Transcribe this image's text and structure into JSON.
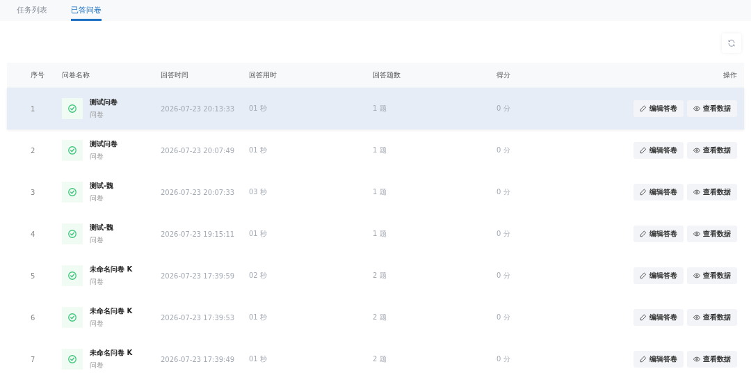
{
  "tabs": [
    {
      "label": "任务列表",
      "selected": false
    },
    {
      "label": "已答问卷",
      "selected": true
    }
  ],
  "table": {
    "columns": [
      "序号",
      "问卷名称",
      "回答时间",
      "回答用时",
      "回答题数",
      "得分",
      "操作"
    ],
    "rows": [
      {
        "index": "1",
        "name": "测试问卷",
        "type": "问卷",
        "time": "2026-07-23 20:13:33",
        "duration": "01 秒",
        "count": "1 题",
        "score": "0 分",
        "selected": true,
        "actions": [
          "编辑答卷",
          "查看数据"
        ]
      },
      {
        "index": "2",
        "name": "测试问卷",
        "type": "问卷",
        "time": "2026-07-23 20:07:49",
        "duration": "01 秒",
        "count": "1 题",
        "score": "0 分",
        "selected": false,
        "actions": [
          "编辑答卷",
          "查看数据"
        ]
      },
      {
        "index": "3",
        "name": "测试-魏",
        "type": "问卷",
        "time": "2026-07-23 20:07:33",
        "duration": "03 秒",
        "count": "1 题",
        "score": "0 分",
        "selected": false,
        "actions": [
          "编辑答卷",
          "查看数据"
        ]
      },
      {
        "index": "4",
        "name": "测试-魏",
        "type": "问卷",
        "time": "2026-07-23 19:15:11",
        "duration": "01 秒",
        "count": "1 题",
        "score": "0 分",
        "selected": false,
        "actions": [
          "编辑答卷",
          "查看数据"
        ]
      },
      {
        "index": "5",
        "name": "未命名问卷 K",
        "type": "问卷",
        "time": "2026-07-23 17:39:59",
        "duration": "02 秒",
        "count": "2 题",
        "score": "0 分",
        "selected": false,
        "actions": [
          "编辑答卷",
          "查看数据"
        ]
      },
      {
        "index": "6",
        "name": "未命名问卷 K",
        "type": "问卷",
        "time": "2026-07-23 17:39:53",
        "duration": "01 秒",
        "count": "2 题",
        "score": "0 分",
        "selected": false,
        "actions": [
          "编辑答卷",
          "查看数据"
        ]
      },
      {
        "index": "7",
        "name": "未命名问卷 K",
        "type": "问卷",
        "time": "2026-07-23 17:39:49",
        "duration": "01 秒",
        "count": "2 题",
        "score": "0 分",
        "selected": false,
        "actions": [
          "编辑答卷",
          "查看数据"
        ]
      }
    ]
  }
}
